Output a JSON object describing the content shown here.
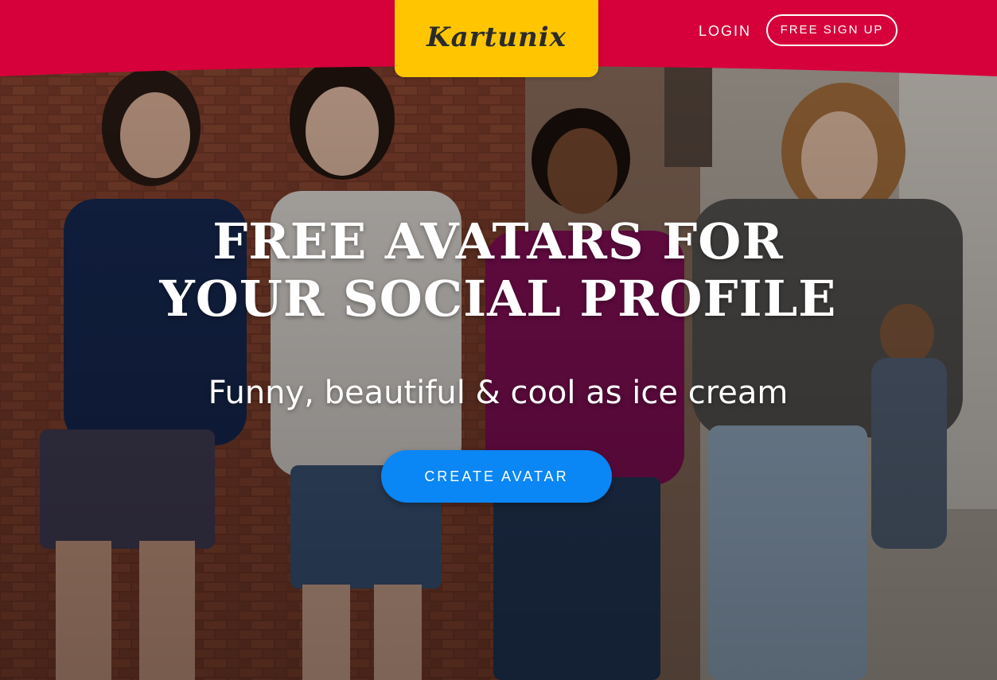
{
  "brand": {
    "logo_text": "Kartunix",
    "primary_color": "#d6003a",
    "logo_bg_color": "#ffc600",
    "cta_color": "#0a86f5"
  },
  "nav": {
    "login_label": "LOGIN",
    "signup_label": "FREE SIGN UP"
  },
  "hero": {
    "headline_line1": "FREE AVATARS FOR",
    "headline_line2": "YOUR SOCIAL PROFILE",
    "tagline": "Funny, beautiful & cool as ice cream",
    "cta_label": "CREATE AVATAR",
    "background_description_icon": "people-photo"
  }
}
